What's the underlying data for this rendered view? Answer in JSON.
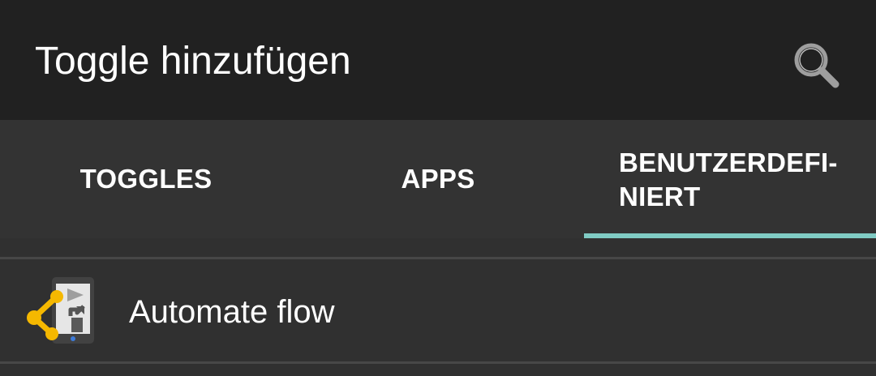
{
  "toolbar": {
    "title": "Toggle hinzufügen",
    "search_icon": "search-icon"
  },
  "tabs": [
    {
      "label": "TOGGLES",
      "selected": false
    },
    {
      "label": "APPS",
      "selected": false
    },
    {
      "label": "BENUTZERDEFI-\nNIERT",
      "selected": true
    }
  ],
  "colors": {
    "toolbar_bg": "#212121",
    "tabbar_bg": "#333333",
    "content_bg": "#303030",
    "indicator": "#80cbc4",
    "icon_accent": "#f5b800"
  },
  "list": {
    "items": [
      {
        "label": "Automate flow",
        "icon": "automate-flow-icon"
      }
    ]
  }
}
